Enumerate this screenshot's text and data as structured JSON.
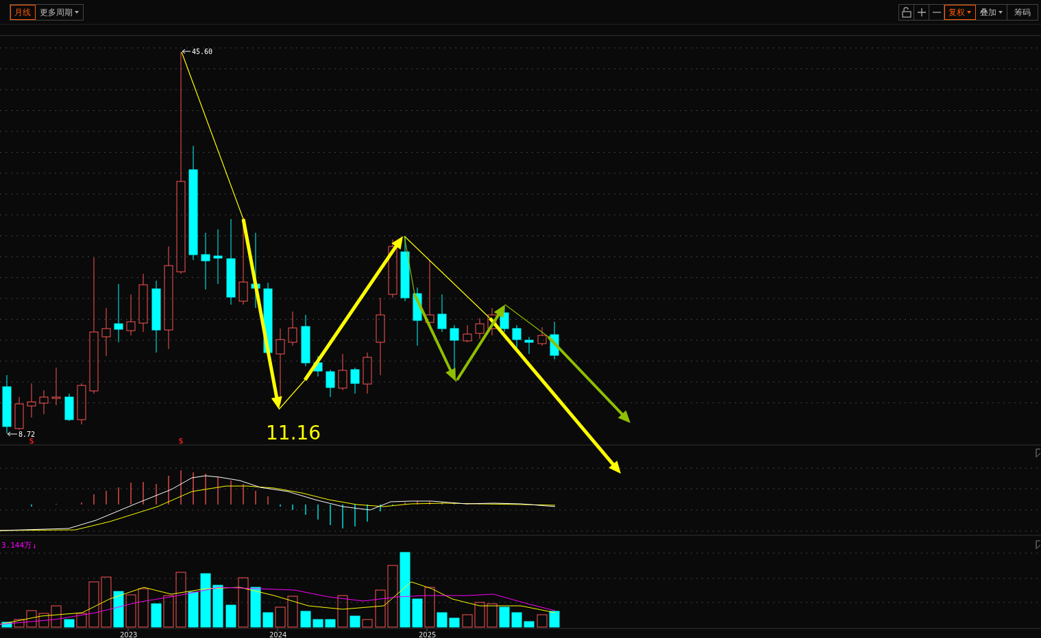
{
  "toolbar": {
    "periods": [
      {
        "kind": "tab",
        "label": "月线",
        "selected": true
      },
      {
        "kind": "dropdown",
        "label": "更多周期",
        "selected": false
      }
    ],
    "tools": [
      {
        "kind": "lock",
        "selected": false
      },
      {
        "kind": "plus",
        "selected": false
      },
      {
        "kind": "minus",
        "selected": false
      },
      {
        "kind": "dropdown",
        "label": "复权",
        "selected": true
      },
      {
        "kind": "dropdown",
        "label": "叠加",
        "selected": false
      },
      {
        "kind": "button",
        "label": "筹码",
        "selected": false
      }
    ]
  },
  "price_chart": {
    "high_label": "45.60",
    "low_label": "8.72",
    "annotation": "11.16",
    "signal_marks": [
      "S",
      "S"
    ]
  },
  "volume_panel": {
    "reading": "3.144万",
    "arrow": "↓"
  },
  "x_axis": {
    "labels": [
      "2023",
      "2024",
      "2025"
    ]
  }
}
